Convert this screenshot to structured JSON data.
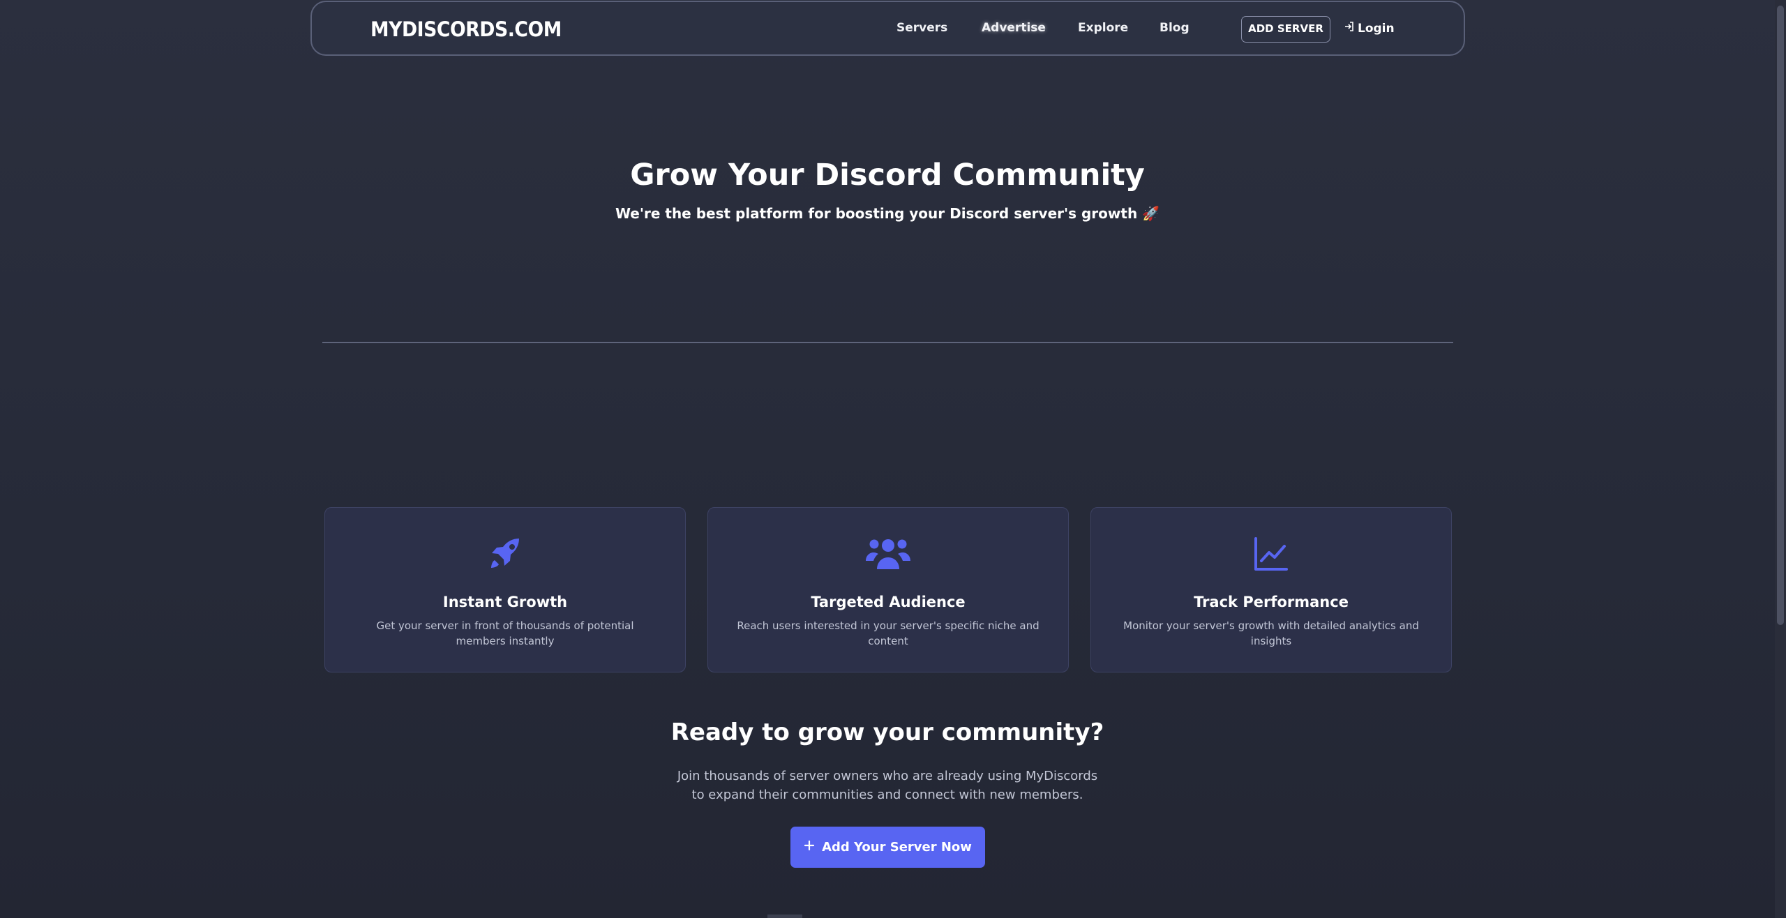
{
  "nav": {
    "logo": "MYDISCORDS.COM",
    "links": [
      "Servers",
      "Advertise",
      "Explore",
      "Blog"
    ],
    "add_server": "ADD SERVER",
    "login": "Login"
  },
  "hero": {
    "title": "Grow Your Discord Community",
    "subtitle": "We're the best platform for boosting your Discord server's growth 🚀"
  },
  "features": [
    {
      "icon": "rocket-icon",
      "title": "Instant Growth",
      "desc": "Get your server in front of thousands of potential members instantly"
    },
    {
      "icon": "users-icon",
      "title": "Targeted Audience",
      "desc": "Reach users interested in your server's specific niche and content"
    },
    {
      "icon": "chart-line-icon",
      "title": "Track Performance",
      "desc": "Monitor your server's growth with detailed analytics and insights"
    }
  ],
  "cta": {
    "title": "Ready to grow your community?",
    "desc_line1": "Join thousands of server owners who are already using MyDiscords",
    "desc_line2": "to expand their communities and connect with new members.",
    "button": "Add Your Server Now"
  },
  "colors": {
    "accent": "#5865f2",
    "background": "#282c3a",
    "card": "#2c3049"
  }
}
